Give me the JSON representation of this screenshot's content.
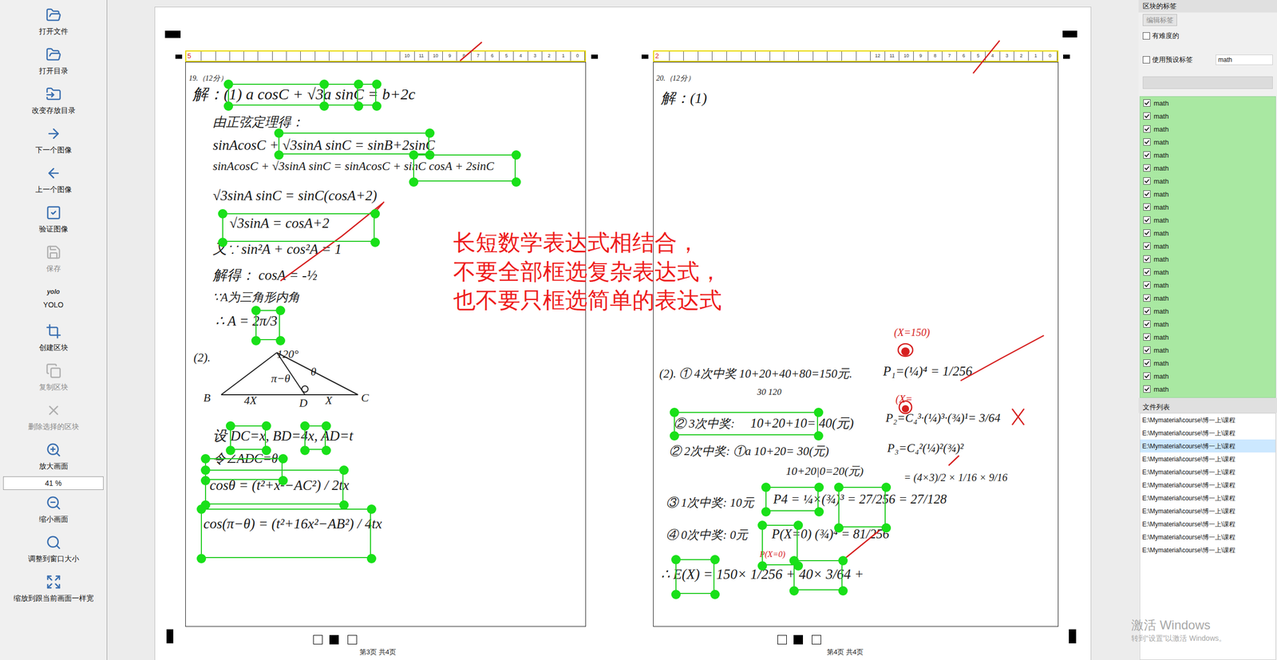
{
  "toolbar": [
    {
      "kind": "button",
      "label": "打开文件",
      "disabled": false
    },
    {
      "kind": "button",
      "label": "打开目录",
      "disabled": false
    },
    {
      "kind": "button",
      "label": "改变存放目录",
      "disabled": false
    },
    {
      "kind": "button",
      "label": "下一个图像",
      "disabled": false
    },
    {
      "kind": "button",
      "label": "上一个图像",
      "disabled": false
    },
    {
      "kind": "button",
      "label": "验证图像",
      "disabled": false
    },
    {
      "kind": "button",
      "label": "保存",
      "disabled": true
    },
    {
      "kind": "text-icon",
      "icon_text": "yolo",
      "label": "YOLO",
      "disabled": false
    },
    {
      "kind": "button",
      "label": "创建区块",
      "disabled": false
    },
    {
      "kind": "button",
      "label": "复制区块",
      "disabled": true
    },
    {
      "kind": "button",
      "label": "删除选择的区块",
      "disabled": true
    },
    {
      "kind": "button",
      "label": "放大画面",
      "disabled": false
    },
    {
      "kind": "field",
      "value": "41 %"
    },
    {
      "kind": "button",
      "label": "缩小画面",
      "disabled": false
    },
    {
      "kind": "button",
      "label": "调整到窗口大小",
      "disabled": false
    },
    {
      "kind": "button",
      "label": "缩放到跟当前画面一样宽",
      "disabled": false
    }
  ],
  "canvas": {
    "note": [
      "长短数学表达式相结合，",
      "不要全部框选复杂表达式，",
      "也不要只框选简单的表达式"
    ],
    "pages": [
      {
        "mark": "5",
        "ruler": [
          "10",
          "11",
          "10",
          "9",
          "8",
          "7",
          "6",
          "5",
          "4",
          "3",
          "2",
          "1",
          "0"
        ],
        "lines": [
          {
            "text": "19.（12分）",
            "color": "#1a1a1a"
          },
          {
            "text": "解：(1) a cosC + √3a sinC = b+2c",
            "color": "#1a1a1a"
          },
          {
            "text": "由正弦定理得：",
            "color": "#1a1a1a"
          },
          {
            "text": "sinAcosC + √3sinA sinC = sinB+2sinC",
            "color": "#1a1a1a"
          },
          {
            "text": "sinAcosC + √3sinA sinC = sinAcosC + sinC cosA + 2sinC",
            "color": "#1a1a1a"
          },
          {
            "text": "√3sinA sinC = sinC(cosA+2)",
            "color": "#1a1a1a"
          },
          {
            "text": "√3sinA = cosA+2",
            "color": "#1a1a1a"
          },
          {
            "text": "又∵ sin²A + cos²A = 1",
            "color": "#1a1a1a"
          },
          {
            "text": "解得： cosA = -½",
            "color": "#1a1a1a"
          },
          {
            "text": "∵A为三角形内角",
            "color": "#1a1a1a"
          },
          {
            "text": "∴ A = 2π/3",
            "color": "#1a1a1a"
          },
          {
            "text": "(2).",
            "color": "#1a1a1a"
          },
          {
            "text": "设 DC=x,  BD=4x,  AD=t",
            "color": "#1a1a1a"
          },
          {
            "text": "令∠ADC=θ",
            "color": "#1a1a1a"
          },
          {
            "text": "cosθ = (t²+x²−AC²) / 2tx",
            "color": "#1a1a1a"
          },
          {
            "text": "cos(π−θ) = (t²+16x²−AB²) / 4tx",
            "color": "#1a1a1a"
          }
        ],
        "figure_labels": [
          "B",
          "4X",
          "D",
          "X",
          "C",
          "π−θ",
          "θ",
          "120°"
        ],
        "footer": "第3页 共4页"
      },
      {
        "mark": "2",
        "ruler": [
          "12",
          "11",
          "10",
          "9",
          "8",
          "7",
          "6",
          "5",
          "4",
          "3",
          "2",
          "1",
          "0"
        ],
        "lines": [
          {
            "text": "20.（12分）",
            "color": "#1a1a1a"
          },
          {
            "text": "解：(1)",
            "color": "#1a1a1a"
          },
          {
            "text": "(X=150)",
            "color": "#d62020"
          },
          {
            "text": "(2). ① 4次中奖 10+20+40+80=150元.",
            "color": "#1a1a1a"
          },
          {
            "text": "P₁=(¼)⁴ = 1/256",
            "color": "#1a1a1a"
          },
          {
            "text": "30        120",
            "color": "#1a1a1a"
          },
          {
            "text": "(X=",
            "color": "#d62020"
          },
          {
            "text": "② 3次中奖:",
            "color": "#1a1a1a"
          },
          {
            "text": "10+20+10= 40(元)",
            "color": "#1a1a1a"
          },
          {
            "text": "P₂=C₄³·(¼)³·(¾)¹= 3/64",
            "color": "#1a1a1a"
          },
          {
            "text": "② 2次中奖: ①a 10+20= 30(元)",
            "color": "#1a1a1a"
          },
          {
            "text": "P₃=C₄²(¼)²(¾)²",
            "color": "#1a1a1a"
          },
          {
            "text": "10+20|0=20(元)",
            "color": "#1a1a1a"
          },
          {
            "text": "= (4×3)/2 × 1/16 × 9/16",
            "color": "#1a1a1a"
          },
          {
            "text": "③ 1次中奖: 10元",
            "color": "#1a1a1a"
          },
          {
            "text": "P4 = ¼×(¾)³ = 27/256 = 27/128",
            "color": "#1a1a1a"
          },
          {
            "text": "④ 0次中奖: 0元",
            "color": "#1a1a1a"
          },
          {
            "text": "P(X=0) (¾)⁴ = 81/256",
            "color": "#1a1a1a"
          },
          {
            "text": "P(X=0)",
            "color": "#d62020"
          },
          {
            "text": "∴ E(X) = 150× 1/256 + 40× 3/64 +",
            "color": "#1a1a1a"
          }
        ],
        "figure_labels": [],
        "footer": "第4页 共4页"
      }
    ]
  },
  "right_panel": {
    "title": "区块的标签",
    "edit_button": {
      "label": "编辑标签",
      "disabled": true
    },
    "difficult": {
      "label": "有难度的",
      "checked": false
    },
    "preset": {
      "label": "使用预设标签",
      "checked": false,
      "value": "math"
    },
    "labels": [
      {
        "text": "math",
        "checked": true
      },
      {
        "text": "math",
        "checked": true
      },
      {
        "text": "math",
        "checked": true
      },
      {
        "text": "math",
        "checked": true
      },
      {
        "text": "math",
        "checked": true
      },
      {
        "text": "math",
        "checked": true
      },
      {
        "text": "math",
        "checked": true
      },
      {
        "text": "math",
        "checked": true
      },
      {
        "text": "math",
        "checked": true
      },
      {
        "text": "math",
        "checked": true
      },
      {
        "text": "math",
        "checked": true
      },
      {
        "text": "math",
        "checked": true
      },
      {
        "text": "math",
        "checked": true
      },
      {
        "text": "math",
        "checked": true
      },
      {
        "text": "math",
        "checked": true
      },
      {
        "text": "math",
        "checked": true
      },
      {
        "text": "math",
        "checked": true
      },
      {
        "text": "math",
        "checked": true
      },
      {
        "text": "math",
        "checked": true
      },
      {
        "text": "math",
        "checked": true
      },
      {
        "text": "math",
        "checked": true
      },
      {
        "text": "math",
        "checked": true
      },
      {
        "text": "math",
        "checked": true
      }
    ],
    "files_title": "文件列表",
    "files": [
      {
        "path": "E:\\Mymaterial\\course\\博一上\\课程",
        "selected": false
      },
      {
        "path": "E:\\Mymaterial\\course\\博一上\\课程",
        "selected": false
      },
      {
        "path": "E:\\Mymaterial\\course\\博一上\\课程",
        "selected": true
      },
      {
        "path": "E:\\Mymaterial\\course\\博一上\\课程",
        "selected": false
      },
      {
        "path": "E:\\Mymaterial\\course\\博一上\\课程",
        "selected": false
      },
      {
        "path": "E:\\Mymaterial\\course\\博一上\\课程",
        "selected": false
      },
      {
        "path": "E:\\Mymaterial\\course\\博一上\\课程",
        "selected": false
      },
      {
        "path": "E:\\Mymaterial\\course\\博一上\\课程",
        "selected": false
      },
      {
        "path": "E:\\Mymaterial\\course\\博一上\\课程",
        "selected": false
      },
      {
        "path": "E:\\Mymaterial\\course\\博一上\\课程",
        "selected": false
      },
      {
        "path": "E:\\Mymaterial\\course\\博一上\\课程",
        "selected": false
      }
    ]
  },
  "watermark": {
    "title": "激活 Windows",
    "subtitle": "转到“设置”以激活 Windows。"
  }
}
